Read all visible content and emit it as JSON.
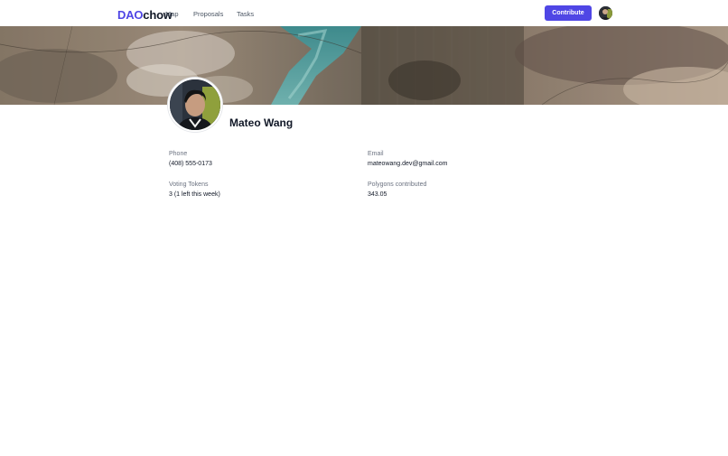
{
  "header": {
    "logo_part1": "DAO",
    "logo_part2": "chow",
    "nav": [
      {
        "label": "Map"
      },
      {
        "label": "Proposals"
      },
      {
        "label": "Tasks"
      }
    ],
    "contribute_label": "Contribute",
    "avatar_icon": "user-avatar-icon"
  },
  "banner": {
    "image_icon": "aerial-landscape-image"
  },
  "profile": {
    "name": "Mateo Wang",
    "avatar_icon": "profile-photo-icon"
  },
  "details": {
    "phone_label": "Phone",
    "phone_value": "(408) 555-0173",
    "email_label": "Email",
    "email_value": "mateowang.dev@gmail.com",
    "tokens_label": "Voting Tokens",
    "tokens_value": "3 (1 left this week)",
    "polygons_label": "Polygons contributed",
    "polygons_value": "343.05"
  },
  "colors": {
    "accent": "#4f46e5",
    "text": "#111827",
    "muted": "#6b7280"
  }
}
